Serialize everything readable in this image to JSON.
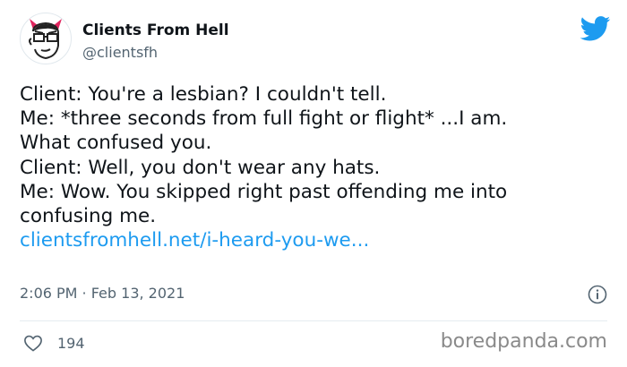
{
  "header": {
    "display_name": "Clients From Hell",
    "handle": "@clientsfh",
    "avatar_icon": "devil-avatar-icon",
    "platform_icon": "twitter-bird-icon",
    "brand_color": "#1d9bf0"
  },
  "tweet": {
    "lines": [
      "Client: You're a lesbian? I couldn't tell.",
      "Me: *three seconds from full fight or flight* ...I am.",
      "What confused you.",
      "Client: Well, you don't wear any hats.",
      "Me: Wow. You skipped right past offending me into",
      "confusing me."
    ],
    "link": "clientsfromhell.net/i-heard-you-we...",
    "timestamp": "2:06 PM · Feb 13, 2021"
  },
  "footer": {
    "like_icon": "heart-icon",
    "like_count": "194",
    "watermark": "boredpanda.com"
  }
}
